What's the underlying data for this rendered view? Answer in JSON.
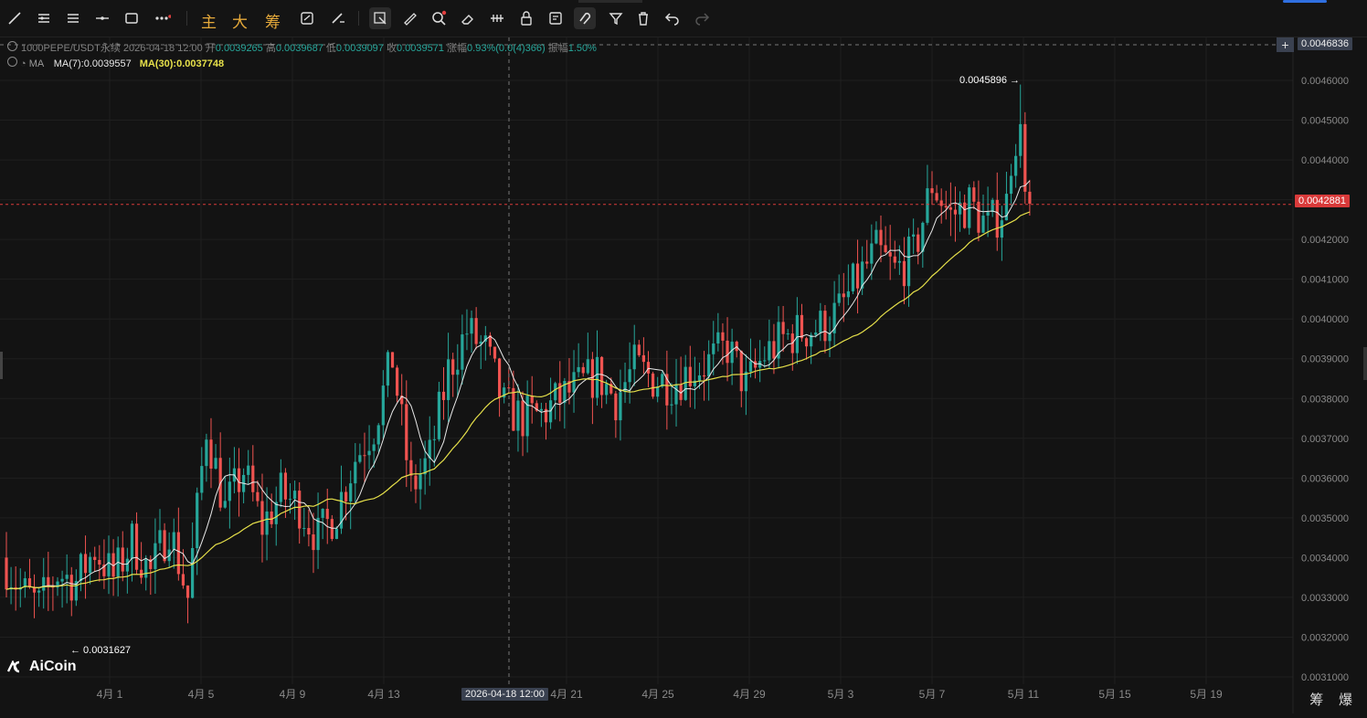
{
  "toolbar": {
    "tools": [
      "line-tool-icon",
      "parallel-lines-icon",
      "horizontal-lines-icon",
      "horizontal-ray-icon",
      "rectangle-icon",
      "more-icon"
    ],
    "text_buttons": [
      "主",
      "大",
      "筹"
    ],
    "right_tools": [
      "screenshot-icon",
      "brush-icon",
      "select-icon",
      "ruler-icon",
      "zoom-icon",
      "eraser-icon",
      "measure-icon",
      "lock-icon",
      "note-icon",
      "magnet-icon",
      "filter-icon",
      "trash-icon",
      "undo-icon",
      "redo-icon"
    ]
  },
  "header": {
    "symbol_line": "1000PEPE/USDT永续  2026-04-18 12:00",
    "open_label": "开",
    "open": "0.0039265",
    "high_label": "高",
    "high": "0.0039687",
    "low_label": "低",
    "low": "0.0039097",
    "close_label": "收",
    "close": "0.0039571",
    "change_label": "涨幅",
    "change": "0.93%(0.0(4)366)",
    "amplitude_label": "振幅",
    "amplitude": "1.50%",
    "ma_label": "MA",
    "ma7": "MA(7):0.0039557",
    "ma30": "MA(30):0.0037748"
  },
  "chart_data": {
    "type": "candlestick",
    "y_ticks": [
      "0.0046000",
      "0.0045000",
      "0.0044000",
      "0.0043000",
      "0.0042000",
      "0.0041000",
      "0.0040000",
      "0.0039000",
      "0.0038000",
      "0.0037000",
      "0.0036000",
      "0.0035000",
      "0.0034000",
      "0.0033000",
      "0.0032000",
      "0.0031000"
    ],
    "x_ticks": [
      "4月 1",
      "4月 5",
      "4月 9",
      "4月 13",
      "4月 21",
      "4月 25",
      "4月 29",
      "5月 3",
      "5月 7",
      "5月 11",
      "5月 15",
      "5月 19"
    ],
    "ylim": [
      0.00307,
      0.00474
    ],
    "crosshair_price": "0.0046836",
    "crosshair_time": "2026-04-18 12:00",
    "last_price": "0.0042881",
    "max_label": "0.0045896 →",
    "min_label": "← 0.0031627",
    "colors": {
      "up": "#26a69a",
      "down": "#ef5350",
      "ma7": "#e8e8e8",
      "ma30": "#e6e04a",
      "last": "#d93a3a",
      "grid": "#1f1f1f"
    },
    "daily_close": [
      0.0034,
      0.00332,
      0.00328,
      0.00336,
      0.00334,
      0.00342,
      0.00335,
      0.00344,
      0.00336,
      0.00348,
      0.0033,
      0.00373,
      0.00352,
      0.00362,
      0.00348,
      0.00356,
      0.00353,
      0.00345,
      0.00352,
      0.00365,
      0.00373,
      0.0039,
      0.00357,
      0.00365,
      0.00387,
      0.00397,
      0.00392,
      0.00378,
      0.00375,
      0.00376,
      0.0038,
      0.00383,
      0.00386,
      0.0038,
      0.00388,
      0.00385,
      0.00384,
      0.00387,
      0.00389,
      0.00393,
      0.00383,
      0.00391,
      0.00395,
      0.00397,
      0.00398,
      0.00402,
      0.0041,
      0.00417,
      0.00412,
      0.00416,
      0.00434,
      0.00426,
      0.00429,
      0.00423,
      0.00429
    ]
  },
  "logo": {
    "text": "AiCoin"
  },
  "bottom_right": "筹 爆"
}
